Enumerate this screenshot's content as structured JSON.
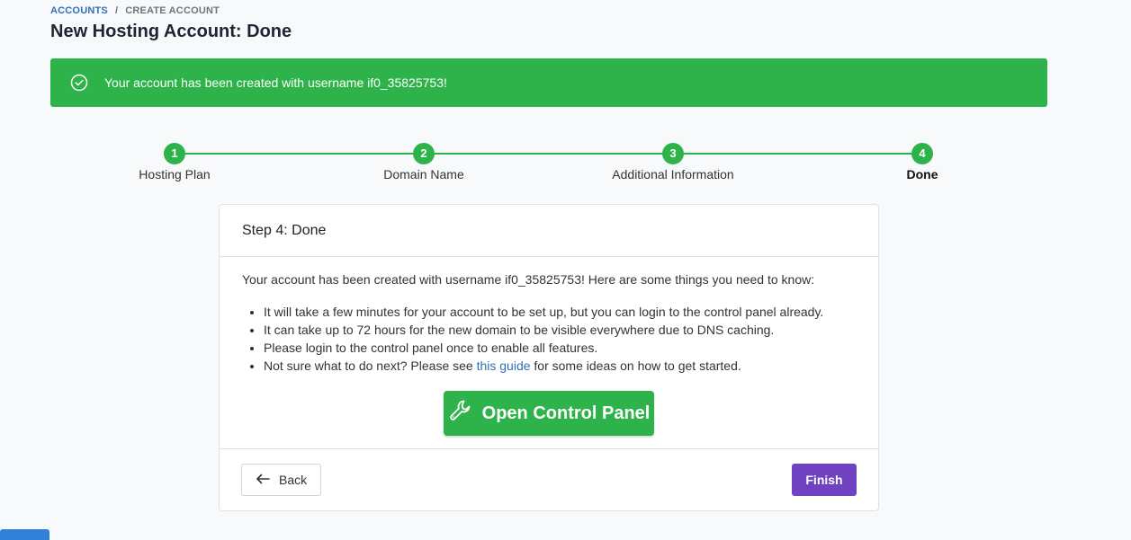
{
  "breadcrumb": {
    "link": "ACCOUNTS",
    "separator": "/",
    "current": "CREATE ACCOUNT"
  },
  "page_title": "New Hosting Account: Done",
  "alert": {
    "text": "Your account has been created with username if0_35825753!",
    "color": "#2eb34a",
    "icon": "check-circle-icon"
  },
  "steps": [
    {
      "number": "1",
      "label": "Hosting Plan"
    },
    {
      "number": "2",
      "label": "Domain Name"
    },
    {
      "number": "3",
      "label": "Additional Information"
    },
    {
      "number": "4",
      "label": "Done",
      "active": true
    }
  ],
  "card": {
    "title": "Step 4: Done",
    "intro": "Your account has been created with username if0_35825753! Here are some things you need to know:",
    "bullets": [
      "It will take a few minutes for your account to be set up, but you can login to the control panel already.",
      "It can take up to 72 hours for the new domain to be visible everywhere due to DNS caching.",
      "Please login to the control panel once to enable all features."
    ],
    "bullet_guide": {
      "before": "Not sure what to do next? Please see ",
      "link": "this guide",
      "after": " for some ideas on how to get started."
    },
    "control_panel_button": "Open Control Panel",
    "back_button": "Back",
    "finish_button": "Finish"
  },
  "colors": {
    "success": "#2eb34a",
    "primary_link": "#2f6fb5",
    "finish": "#6f42c1"
  }
}
